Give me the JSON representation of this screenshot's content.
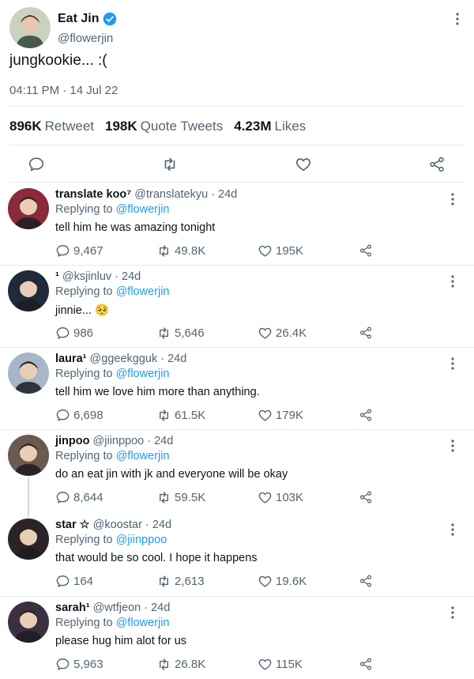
{
  "tweet": {
    "author_name": "Eat Jin",
    "author_handle": "@flowerjin",
    "text": "jungkookie... :(",
    "timestamp": "04:11 PM · 14 Jul 22",
    "stats": {
      "retweets_value": "896K",
      "retweets_label": "Retweet",
      "quotes_value": "198K",
      "quotes_label": "Quote Tweets",
      "likes_value": "4.23M",
      "likes_label": "Likes"
    }
  },
  "replies": [
    {
      "name": "translate koo⁷",
      "handle": "@translatekyu · 24d",
      "replying_prefix": "Replying to",
      "replying_to": "@flowerjin",
      "text": "tell him he was amazing tonight",
      "replies": "9,467",
      "retweets": "49.8K",
      "likes": "195K",
      "avatar_color": "#8a2a3a"
    },
    {
      "name": "¹",
      "handle": "@ksjinluv · 24d",
      "replying_prefix": "Replying to",
      "replying_to": "@flowerjin",
      "text": "jinnie... 🥺",
      "replies": "986",
      "retweets": "5,646",
      "likes": "26.4K",
      "avatar_color": "#1f2a3a"
    },
    {
      "name": "laura¹",
      "handle": "@ggeekgguk · 24d",
      "replying_prefix": "Replying to",
      "replying_to": "@flowerjin",
      "text": "tell him we love him more than anything.",
      "replies": "6,698",
      "retweets": "61.5K",
      "likes": "179K",
      "avatar_color": "#a7b6c8"
    },
    {
      "name": "jinpoo",
      "handle": "@jiinppoo · 24d",
      "replying_prefix": "Replying to",
      "replying_to": "@flowerjin",
      "text": "do an eat jin with jk and everyone will be okay",
      "replies": "8,644",
      "retweets": "59.5K",
      "likes": "103K",
      "avatar_color": "#6b5a50"
    },
    {
      "name": "star ☆",
      "handle": "@koostar · 24d",
      "replying_prefix": "Replying to",
      "replying_to": "@jiinppoo",
      "text": "that would be so cool. I hope it happens",
      "replies": "164",
      "retweets": "2,613",
      "likes": "19.6K",
      "avatar_color": "#2b2426"
    },
    {
      "name": "sarah¹",
      "handle": "@wtfjeon · 24d",
      "replying_prefix": "Replying to",
      "replying_to": "@flowerjin",
      "text": "please hug him alot for us",
      "replies": "5,963",
      "retweets": "26.8K",
      "likes": "115K",
      "avatar_color": "#3a3040"
    }
  ],
  "colors": {
    "verified": "#1d9bf0",
    "link": "#1d9bf0",
    "muted": "#536471"
  }
}
